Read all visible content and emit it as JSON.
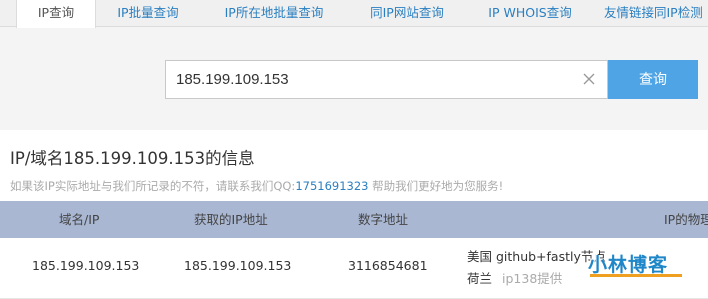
{
  "tabs": [
    {
      "label": "IP查询",
      "active": true
    },
    {
      "label": "IP批量查询",
      "active": false
    },
    {
      "label": "IP所在地批量查询",
      "active": false
    },
    {
      "label": "同IP网站查询",
      "active": false
    },
    {
      "label": "IP WHOIS查询",
      "active": false
    },
    {
      "label": "友情链接同IP检测",
      "active": false
    }
  ],
  "search": {
    "value": "185.199.109.153",
    "clear_icon": "close-icon",
    "button_label": "查询"
  },
  "info": {
    "title": "IP/域名185.199.109.153的信息",
    "notice_prefix": "如果该IP实际地址与我们所记录的不符，请联系我们QQ:",
    "notice_qq": "1751691323",
    "notice_suffix": " 帮助我们更好地为您服务!"
  },
  "table": {
    "headers": [
      "域名/IP",
      "获取的IP地址",
      "数字地址",
      "IP的物理位置"
    ],
    "row": {
      "domain_ip": "185.199.109.153",
      "fetched_ip": "185.199.109.153",
      "numeric": "3116854681",
      "location_line1": "美国 github+fastly节点",
      "location_line2": "荷兰",
      "provider": "ip138提供"
    }
  },
  "watermark": "小林博客",
  "colors": {
    "link": "#2a7fc0",
    "button": "#4ea4e5",
    "table_header": "#a9b7d3",
    "watermark": "#1f86c8",
    "watermark_accent": "#f0a020"
  }
}
